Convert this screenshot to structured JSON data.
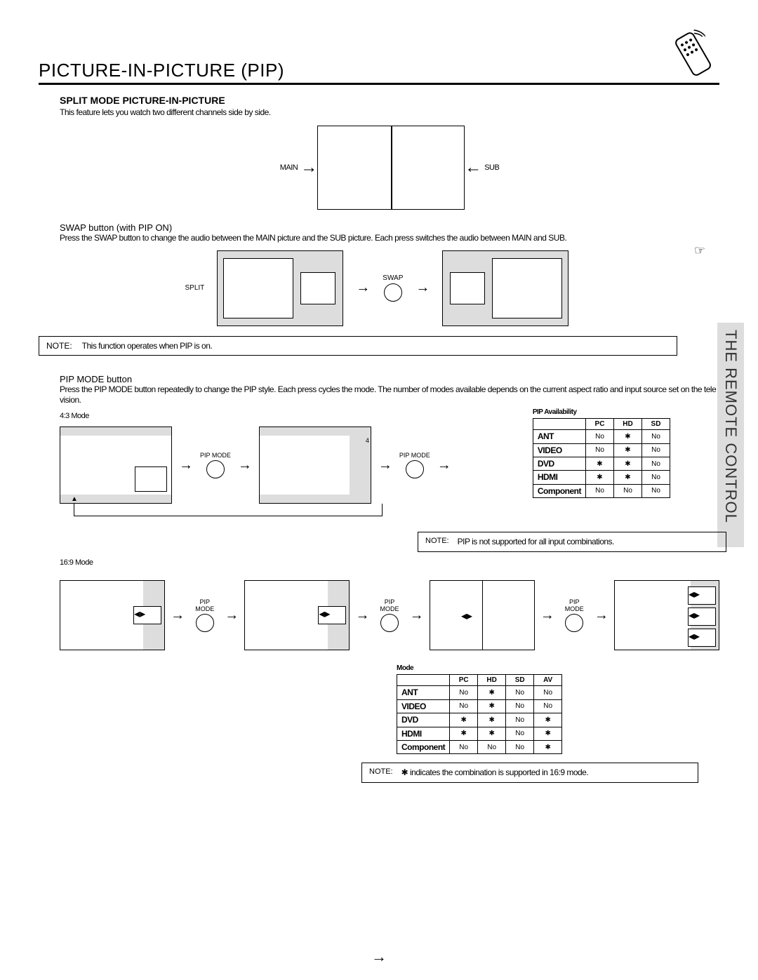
{
  "title": "PICTURE-IN-PICTURE (PIP)",
  "side_tab": "THE REMOTE CONTROL",
  "section1": {
    "heading": "SPLIT MODE PICTURE-IN-PICTURE",
    "desc": "This feature lets you watch two different channels side by side.",
    "main_label": "MAIN",
    "pip_label": "SUB"
  },
  "section2": {
    "heading": "SWAP button (with PIP ON)",
    "desc1": "Press the SWAP button to change the audio between the MAIN picture and the SUB picture. Each press switches the audio between MAIN and SUB.",
    "split_label": "SPLIT",
    "swap_label": "SWAP"
  },
  "note1": {
    "label": "NOTE:",
    "text": "This function operates when PIP is on."
  },
  "section3": {
    "heading": "PIP MODE button",
    "desc": "Press the PIP MODE button repeatedly to change the PIP style. Each press cycles the mode. The number of modes available depends on the current aspect ratio and input source set on the television.",
    "aspect_43": "4:3 Mode",
    "aspect_169": "16:9 Mode",
    "pip_mode_label": "PIP MODE",
    "step4": "4"
  },
  "table1": {
    "title": "PIP Availability",
    "cols": [
      "",
      "PC",
      "HD",
      "SD"
    ],
    "rows": [
      [
        "ANT",
        "No",
        "✱",
        "No"
      ],
      [
        "VIDEO",
        "No",
        "✱",
        "No"
      ],
      [
        "DVD",
        "✱",
        "✱",
        "No"
      ],
      [
        "HDMI",
        "✱",
        "✱",
        "No"
      ],
      [
        "Component",
        "No",
        "No",
        "No"
      ]
    ]
  },
  "note2": {
    "label": "NOTE:",
    "text": "PIP is not supported for all input combinations."
  },
  "table2": {
    "title": "Mode",
    "cols": [
      "",
      "PC",
      "HD",
      "SD",
      "AV"
    ],
    "rows": [
      [
        "ANT",
        "No",
        "✱",
        "No",
        "No"
      ],
      [
        "VIDEO",
        "No",
        "✱",
        "No",
        "No"
      ],
      [
        "DVD",
        "✱",
        "✱",
        "No",
        "✱"
      ],
      [
        "HDMI",
        "✱",
        "✱",
        "No",
        "✱"
      ],
      [
        "Component",
        "No",
        "No",
        "No",
        "✱"
      ]
    ]
  },
  "note3": {
    "label": "NOTE:",
    "text": "✱ indicates the combination is supported in 16:9 mode."
  }
}
